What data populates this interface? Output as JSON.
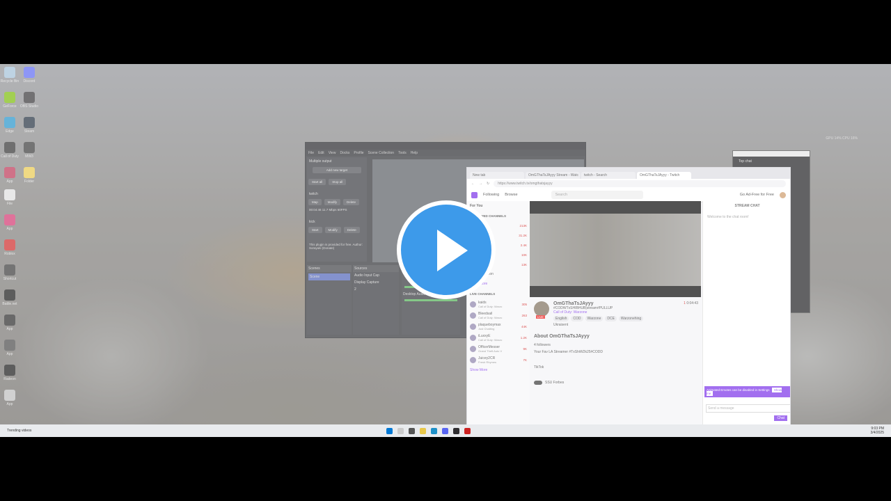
{
  "desktop_icons": [
    {
      "label": "Recycle Bin",
      "color": "#9fbfd6"
    },
    {
      "label": "Discord",
      "color": "#5865f2"
    },
    {
      "label": "GeForce",
      "color": "#76b900"
    },
    {
      "label": "OBS Studio",
      "color": "#302e31"
    },
    {
      "label": "Edge",
      "color": "#1e90c8"
    },
    {
      "label": "Steam",
      "color": "#1b2838"
    },
    {
      "label": "Call of Duty",
      "color": "#2b2b2b"
    },
    {
      "label": "MW3",
      "color": "#333"
    },
    {
      "label": "App",
      "color": "#b83050"
    },
    {
      "label": "Folder",
      "color": "#e8c74a"
    },
    {
      "label": "File",
      "color": "#ddd"
    },
    {
      "label": "App",
      "color": "#d0306a"
    },
    {
      "label": "Roblox",
      "color": "#c22"
    },
    {
      "label": "Shortcut",
      "color": "#333"
    },
    {
      "label": "Battle.net",
      "color": "#111"
    },
    {
      "label": "App",
      "color": "#222"
    },
    {
      "label": "App",
      "color": "#444"
    },
    {
      "label": "Radeon",
      "color": "#111"
    },
    {
      "label": "App",
      "color": "#bbb"
    }
  ],
  "system_stats": "GPU 14%  CPU 16%",
  "obs": {
    "menu": [
      "File",
      "Edit",
      "View",
      "Docks",
      "Profile",
      "Scene Collection",
      "Tools",
      "Help"
    ],
    "panel_title": "Multiple output",
    "add_target": "Add new target",
    "start_all": "Start all",
    "stop_all": "Stop all",
    "twitch_label": "twitch",
    "map": "Map",
    "modify": "Modify",
    "delete": "Delete",
    "twitch_stats": "00:04:46 11.7 Mbps 60FPS",
    "kick_label": "kick",
    "start": "Start",
    "plugin_note": "This plugin is provided for free. Author: Sorayuki (Donate)",
    "scenes_title": "Scenes",
    "scene_item": "Scene",
    "sources_title": "Sources",
    "sources": [
      "Audio Input Cap",
      "Display Capture",
      "2"
    ],
    "mixer_label": "Desktop Audio",
    "status": "Dropped Frames 0/60 (0.0%)"
  },
  "browser": {
    "tabs": [
      "New tab",
      "OmGThaTsJAyyy Stream - Watc",
      "twitch - Search",
      "OmGThaTsJAyyy - Twitch"
    ],
    "url": "https://www.twitch.tv/omgthatsjayyy",
    "nav": [
      "Following",
      "Browse"
    ],
    "search_placeholder": "Search",
    "ad_free": "Go Ad-Free for Free",
    "for_you": "For You",
    "followed_header": "FOLLOWED CHANNELS",
    "followed": [
      {
        "name": "",
        "live": "213K"
      },
      {
        "name": "",
        "live": "31.2K"
      },
      {
        "name": "",
        "live": "2.4K"
      },
      {
        "name": "",
        "live": "10K"
      },
      {
        "name": "",
        "live": "13K"
      },
      {
        "name": "MrGibbon",
        "live": ""
      }
    ],
    "show_more": "Show More",
    "live_header": "LIVE CHANNELS",
    "live": [
      {
        "name": "kaids",
        "sub": "Call of Duty: Warzo",
        "viewers": "305"
      },
      {
        "name": "Bleedsail",
        "sub": "Call of Duty: Warzo",
        "viewers": "263"
      },
      {
        "name": "plaqueboymax",
        "sub": "Just Chatting",
        "viewers": "44K"
      },
      {
        "name": "iLuxxyE",
        "sub": "Call of Duty: Warzo",
        "viewers": "1.2K"
      },
      {
        "name": "OfficerMesser",
        "sub": "Grand Theft Auto V",
        "viewers": "9K"
      },
      {
        "name": "Juicey2CR",
        "sub": "Fresh Rhymes",
        "viewers": "7K"
      }
    ],
    "show_more2": "Show More",
    "channel": "OmGThaTsJAyyy",
    "stream_title": "#CODWTxSHIBHUB|stream#PULLUP",
    "game": "Call of Duty: Warzone",
    "tags": [
      "English",
      "COD",
      "Warzone",
      "DCE",
      "Warzonehing"
    ],
    "tag2": "Ukraisent",
    "viewers": "1",
    "uptime": "0:04:43",
    "about": "About OmGThaTsJAyyy",
    "followers": "4 followers",
    "about_text": "Your Fav LA Streamer #TxShiW2k25#CODD",
    "tiktok": "TikTok",
    "ssu": "SSU Forbes",
    "chat_title": "STREAM CHAT",
    "chat_welcome": "Welcome to the chat room!",
    "toast": "Animated Emotes can be disabled in Settings",
    "toast_btn": "Show me",
    "chat_placeholder": "Send a message",
    "chat_btn": "Chat",
    "live_badge": "LIVE"
  },
  "top_chat": {
    "title": "Top chat"
  },
  "taskbar": {
    "notice": "Trending videos",
    "time": "9:03 PM",
    "date": "3/4/2025"
  }
}
